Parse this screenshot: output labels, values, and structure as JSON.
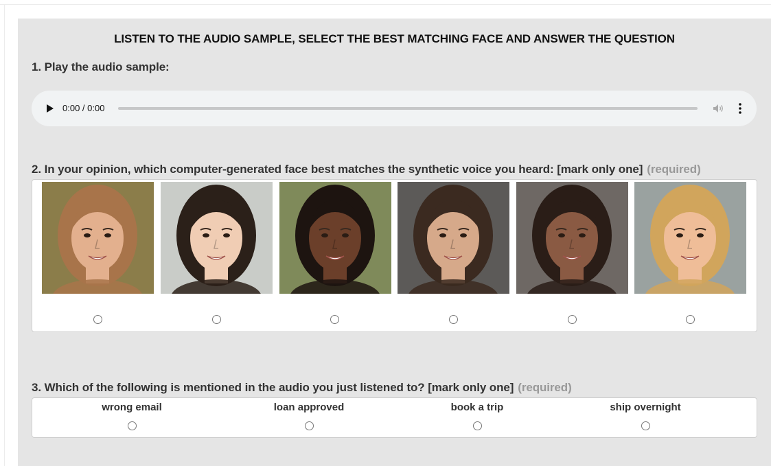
{
  "instruction": "LISTEN TO THE AUDIO SAMPLE, SELECT THE BEST MATCHING FACE AND ANSWER THE QUESTION",
  "question1": {
    "title": "1. Play the audio sample:"
  },
  "audio_player": {
    "time": "0:00 / 0:00",
    "progress": 0,
    "icons": [
      "play-icon",
      "volume-icon",
      "more-options-icon"
    ]
  },
  "question2": {
    "title": "2. In your opinion, which computer-generated face best matches the synthetic voice you heard: [mark only one]",
    "required": "(required)",
    "faces": [
      {
        "hair": "#a8744a",
        "skin": "#e3b08e",
        "bg": "#8b7d4a"
      },
      {
        "hair": "#2b2019",
        "skin": "#f0cdb4",
        "bg": "#c9ccc8"
      },
      {
        "hair": "#1d1410",
        "skin": "#6b3f2a",
        "bg": "#7f8a5a"
      },
      {
        "hair": "#3b2a20",
        "skin": "#d6a98a",
        "bg": "#5c5a58"
      },
      {
        "hair": "#2a1d17",
        "skin": "#8a5a43",
        "bg": "#6e6864"
      },
      {
        "hair": "#d1a55c",
        "skin": "#efbd98",
        "bg": "#9aa2a0"
      }
    ]
  },
  "question3": {
    "title": "3. Which of the following is mentioned in the audio you just listened to? [mark only one]",
    "required": "(required)",
    "options": [
      "wrong email",
      "loan approved",
      "book a trip",
      "ship overnight"
    ]
  }
}
